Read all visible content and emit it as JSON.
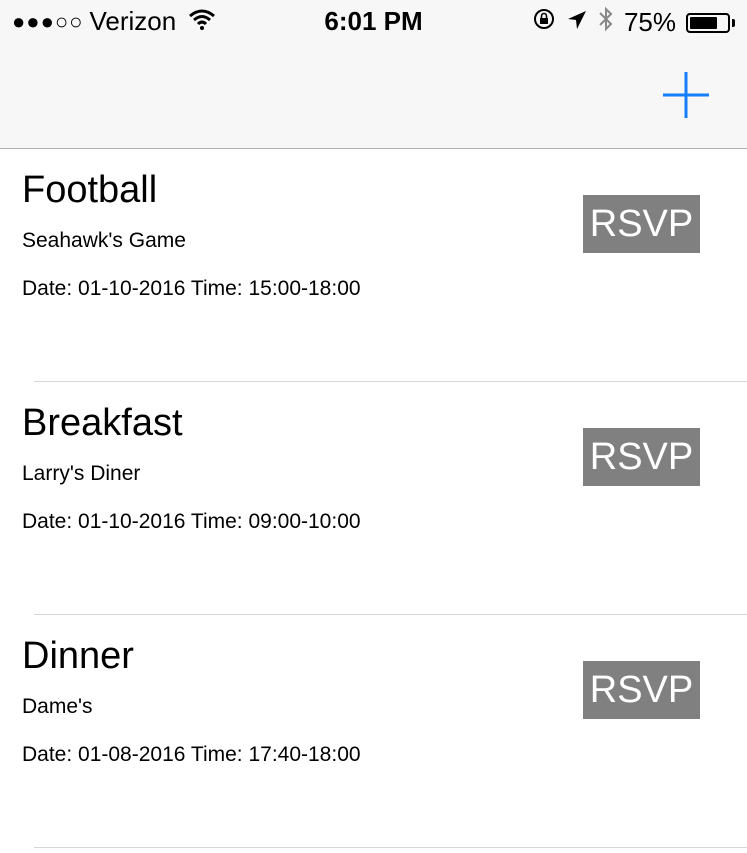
{
  "status_bar": {
    "signal": "●●●○○",
    "carrier": "Verizon",
    "time": "6:01 PM",
    "battery_percent": "75%",
    "battery_level": 0.75
  },
  "nav": {
    "add_icon": "plus-icon",
    "accent_color": "#147efb"
  },
  "events": [
    {
      "title": "Football",
      "subtitle": "Seahawk's Game",
      "datetime": "Date: 01-10-2016 Time: 15:00-18:00",
      "button": "RSVP"
    },
    {
      "title": "Breakfast",
      "subtitle": "Larry's Diner",
      "datetime": "Date: 01-10-2016 Time: 09:00-10:00",
      "button": "RSVP"
    },
    {
      "title": "Dinner",
      "subtitle": "Dame's",
      "datetime": "Date: 01-08-2016 Time: 17:40-18:00",
      "button": "RSVP"
    }
  ]
}
